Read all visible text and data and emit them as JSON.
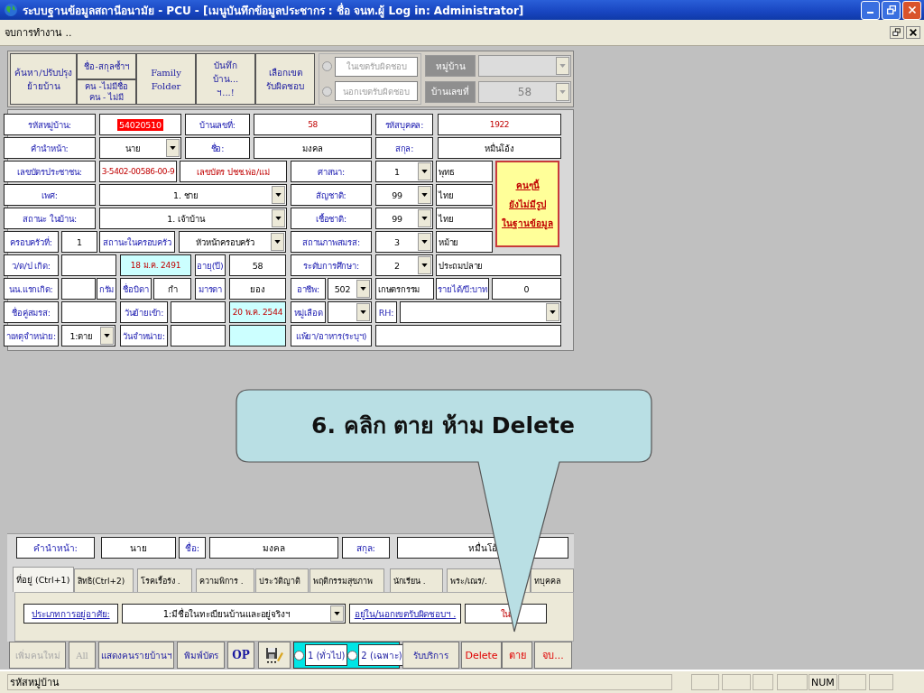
{
  "window": {
    "title": "ระบบฐานข้อมูลสถานีอนามัย - PCU - [เมนูบันทึกข้อมูลประชากร : ชื่อ จนท.ผู้ Log in: Administrator]"
  },
  "menu": {
    "items": [
      "จบการทำงาน .."
    ]
  },
  "toolbar": {
    "items": [
      {
        "kind": "button",
        "lines": [
          "ค้นหา/ปรับปรุง",
          "ย้ายบ้าน"
        ]
      },
      {
        "kind": "stack",
        "buttons": [
          {
            "lines": [
              "ชื่อ-สกุลซ้ำฯ"
            ]
          },
          {
            "lines": [
              "คน -ไม่มีชื่อ",
              "คน - ไม่มี"
            ]
          }
        ]
      },
      {
        "kind": "button",
        "lines": [
          "Family",
          "Folder"
        ]
      },
      {
        "kind": "button",
        "lines": [
          "บันทึก",
          "บ้าน...",
          "ฯ...!"
        ]
      },
      {
        "kind": "button",
        "lines": [
          "เลือกเขต",
          "รับผิดชอบ"
        ]
      }
    ],
    "zone_options": [
      {
        "label": "ในเขตรับผิดชอบ",
        "selected": false,
        "disabled": true
      },
      {
        "label": "นอกเขตรับผิดชอบ",
        "selected": false,
        "disabled": true
      }
    ],
    "filters": [
      {
        "label": "หมู่บ้าน",
        "disabled": true
      },
      {
        "label": "บ้านเลขที่",
        "value": "58",
        "disabled": true
      }
    ]
  },
  "form": {
    "lines": [
      {
        "fields": [
          {
            "kind": "label",
            "text": "รหัสหมู่บ้าน:"
          },
          {
            "kind": "selected",
            "text": "54020510"
          },
          {
            "kind": "label",
            "text": "บ้านเลขที่:"
          },
          {
            "kind": "code",
            "text": "58"
          },
          {
            "kind": "label",
            "text": "รหัสบุคคล:"
          },
          {
            "kind": "code",
            "text": "1922"
          }
        ]
      },
      {
        "fields": [
          {
            "kind": "label",
            "text": "คำนำหน้า:"
          },
          {
            "kind": "select",
            "text": "นาย"
          },
          {
            "kind": "label",
            "text": "ชื่อ:"
          },
          {
            "kind": "value",
            "text": "มงคล"
          },
          {
            "kind": "label",
            "text": "สกุล:"
          },
          {
            "kind": "value",
            "text": "หมื่นโอ้ง"
          }
        ]
      },
      {
        "fields": [
          {
            "kind": "label",
            "text": "เลขบัตรประชาชน:"
          },
          {
            "kind": "code",
            "text": "3-5402-00586-00-9"
          },
          {
            "kind": "warn",
            "text": "เลขบัตร ปชช.พ่อ/แม่"
          },
          {
            "kind": "label",
            "text": "ศาสนา:"
          },
          {
            "kind": "select",
            "text": "1"
          },
          {
            "kind": "text",
            "text": "พุทธ"
          }
        ]
      },
      {
        "fields": [
          {
            "kind": "label",
            "text": "เพศ:"
          },
          {
            "kind": "select",
            "text": "1. ชาย"
          },
          {
            "kind": "label",
            "text": "สัญชาติ:"
          },
          {
            "kind": "select",
            "text": "99"
          },
          {
            "kind": "text",
            "text": "ไทย"
          }
        ]
      },
      {
        "fields": [
          {
            "kind": "label",
            "text": "สถานะ ในบ้าน:"
          },
          {
            "kind": "select",
            "text": "1. เจ้าบ้าน"
          },
          {
            "kind": "label",
            "text": "เชื้อชาติ:"
          },
          {
            "kind": "select",
            "text": "99"
          },
          {
            "kind": "text",
            "text": "ไทย"
          }
        ]
      },
      {
        "fields": [
          {
            "kind": "label",
            "text": "ครอบครัวที่:"
          },
          {
            "kind": "value",
            "text": "1"
          },
          {
            "kind": "label",
            "text": "สถานะในครอบครัว"
          },
          {
            "kind": "select",
            "text": "หัวหน้าครอบครัว"
          },
          {
            "kind": "label",
            "text": "สถานภาพสมรส:"
          },
          {
            "kind": "select",
            "text": "3"
          },
          {
            "kind": "text",
            "text": "หม้าย"
          }
        ]
      },
      {
        "fields": [
          {
            "kind": "label",
            "text": "ว/ด/ป เกิด:"
          },
          {
            "kind": "value"
          },
          {
            "kind": "date",
            "text": "18 ม.ค. 2491"
          },
          {
            "kind": "label",
            "text": "อายุ(ปี)"
          },
          {
            "kind": "value",
            "text": "58"
          },
          {
            "kind": "label",
            "text": "ระดับการศึกษา:"
          },
          {
            "kind": "select",
            "text": "2"
          },
          {
            "kind": "text",
            "text": "ประถมปลาย"
          }
        ]
      },
      {
        "fields": [
          {
            "kind": "label",
            "text": "นน.แรกเกิด:"
          },
          {
            "kind": "value"
          },
          {
            "kind": "label",
            "text": "กรัม"
          },
          {
            "kind": "label",
            "text": "ชื่อบิดา"
          },
          {
            "kind": "value",
            "text": "กำ"
          },
          {
            "kind": "label",
            "text": "มารดา"
          },
          {
            "kind": "value",
            "text": "ยอง"
          },
          {
            "kind": "label",
            "text": "อาชีพ:"
          },
          {
            "kind": "select",
            "text": "502"
          },
          {
            "kind": "text",
            "text": "เกษตรกรรม"
          },
          {
            "kind": "label",
            "text": "รายได้/ปี:บาท"
          },
          {
            "kind": "value",
            "text": "0"
          }
        ]
      },
      {
        "fields": [
          {
            "kind": "label",
            "text": "ชื่อคู่สมรส:"
          },
          {
            "kind": "value"
          },
          {
            "kind": "label",
            "text": "วันย้ายเข้า:"
          },
          {
            "kind": "value"
          },
          {
            "kind": "date",
            "text": "20 พ.ค. 2544"
          },
          {
            "kind": "label",
            "text": "หมู่เลือด"
          },
          {
            "kind": "select"
          },
          {
            "kind": "label",
            "text": "RH:"
          },
          {
            "kind": "select"
          }
        ]
      },
      {
        "fields": [
          {
            "kind": "label",
            "text": "าเหตุจำหน่าย:"
          },
          {
            "kind": "select",
            "text": "1:ตาย"
          },
          {
            "kind": "label",
            "text": "วันจำหน่าย:"
          },
          {
            "kind": "value"
          },
          {
            "kind": "date"
          },
          {
            "kind": "label",
            "text": "แพ้ยา/อาหาร(ระบุฯ)"
          },
          {
            "kind": "value"
          }
        ]
      }
    ],
    "photo_notice": {
      "lines": [
        "คนๆนี้",
        "ยังไม่มีรูป",
        "ในฐานข้อมูล"
      ]
    }
  },
  "person": {
    "fields": [
      {
        "kind": "label",
        "text": "คำนำหน้า:"
      },
      {
        "kind": "value",
        "text": "นาย"
      },
      {
        "kind": "label",
        "text": "ชื่อ:"
      },
      {
        "kind": "value",
        "text": "มงคล"
      },
      {
        "kind": "label",
        "text": "สกุล:"
      },
      {
        "kind": "value",
        "text": "หมื่นโอ้"
      }
    ]
  },
  "tabs": [
    {
      "label": "ที่อยู่ (Ctrl+1)",
      "selected": true
    },
    {
      "label": "สิทธิ(Ctrl+2)",
      "selected": false
    },
    {
      "label": "โรคเรื้อรัง .",
      "selected": false
    },
    {
      "label": "ความพิการ .",
      "selected": false
    },
    {
      "label": "ประวัติญาติ",
      "selected": false
    },
    {
      "label": "พฤติกรรมสุขภาพ",
      "selected": false
    },
    {
      "label": "นักเรียน .",
      "selected": false
    },
    {
      "label": "พระ/เณร/.",
      "selected": false
    },
    {
      "label": "ทบุคคล",
      "selected": false
    }
  ],
  "address": {
    "fields": [
      {
        "kind": "link",
        "text": "ประเภทการอยู่อาศัย:"
      },
      {
        "kind": "select",
        "text": "1:มีชื่อในทะเบียนบ้านและอยู่จริงฯ"
      },
      {
        "kind": "link",
        "text": "อยู่ใน/นอกเขตรับผิดชอบฯ ."
      },
      {
        "kind": "code",
        "text": "ใน"
      }
    ]
  },
  "actions": [
    {
      "kind": "button",
      "label": "เพิ่มคนใหม่",
      "disabled": true
    },
    {
      "kind": "button",
      "label": "All",
      "disabled": true
    },
    {
      "kind": "button",
      "label": "แสดงคนรายบ้านฯ",
      "disabled": false
    },
    {
      "kind": "button",
      "label": "พิมพ์บัตร",
      "disabled": false
    },
    {
      "kind": "strong",
      "label": "OP",
      "disabled": false
    },
    {
      "kind": "icon",
      "disabled": false
    },
    {
      "kind": "radios",
      "options": [
        {
          "label": "1 (ทั่วไป)",
          "selected": false
        },
        {
          "label": "2 (เฉพาะ)",
          "selected": false
        }
      ]
    },
    {
      "kind": "button",
      "label": "รับบริการ",
      "disabled": false
    },
    {
      "kind": "danger",
      "label": "Delete",
      "disabled": false
    },
    {
      "kind": "danger",
      "label": "ตาย",
      "disabled": false
    },
    {
      "kind": "danger",
      "label": "จบ...",
      "disabled": false
    }
  ],
  "status_bar": {
    "message": "รหัสหมู่บ้าน",
    "indicators": [
      "NUM"
    ]
  },
  "callout": {
    "text": "6. คลิก ตาย ห้าม Delete"
  }
}
